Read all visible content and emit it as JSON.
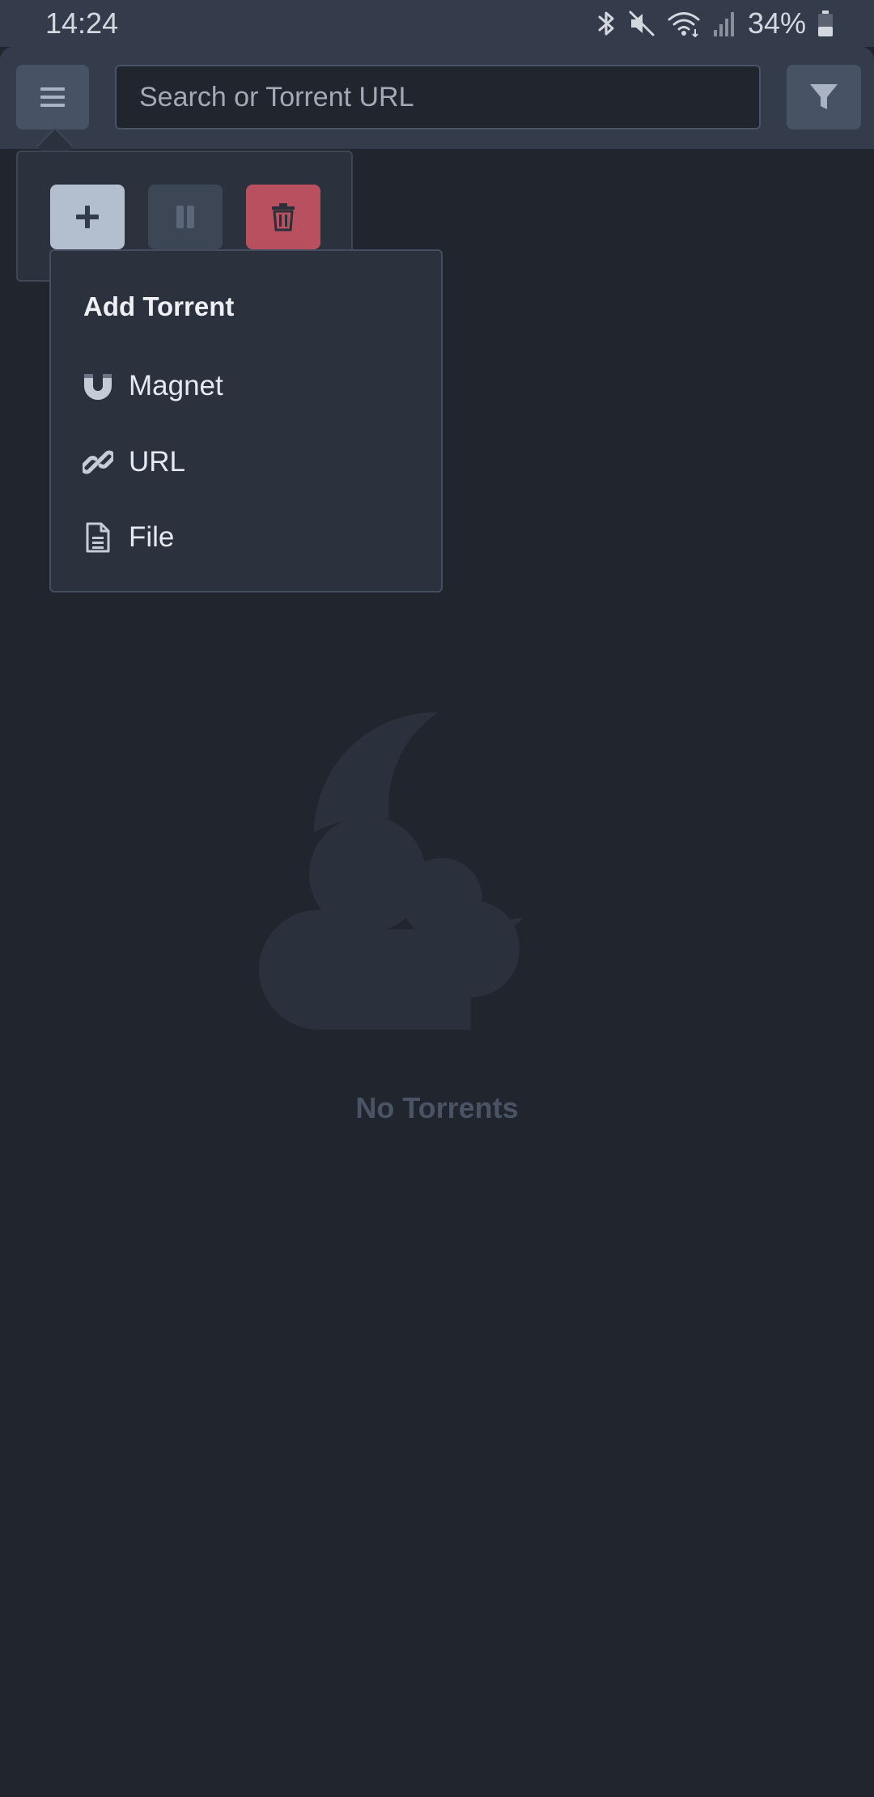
{
  "status_bar": {
    "time": "14:24",
    "battery": "34%",
    "icons": [
      "bluetooth-icon",
      "mute-icon",
      "wifi-icon",
      "signal-icon",
      "battery-icon"
    ]
  },
  "toolbar": {
    "search_placeholder": "Search or Torrent URL",
    "search_value": "",
    "menu_icon": "hamburger-icon",
    "filter_icon": "filter-icon"
  },
  "actions": [
    {
      "name": "add",
      "icon": "plus-icon"
    },
    {
      "name": "pause",
      "icon": "pause-icon"
    },
    {
      "name": "delete",
      "icon": "trash-icon"
    }
  ],
  "add_menu": {
    "title": "Add Torrent",
    "items": [
      {
        "label": "Magnet",
        "icon": "magnet-icon"
      },
      {
        "label": "URL",
        "icon": "link-icon"
      },
      {
        "label": "File",
        "icon": "file-icon"
      }
    ]
  },
  "empty_state": {
    "icon": "cloud-moon-icon",
    "text": "No Torrents"
  },
  "colors": {
    "background": "#20252e",
    "topbar": "#343c4b",
    "button": "#475265",
    "add_button": "#b3bfcf",
    "delete_button": "#b85060",
    "menu_bg": "#2b313d",
    "empty_text": "#4a5464"
  }
}
